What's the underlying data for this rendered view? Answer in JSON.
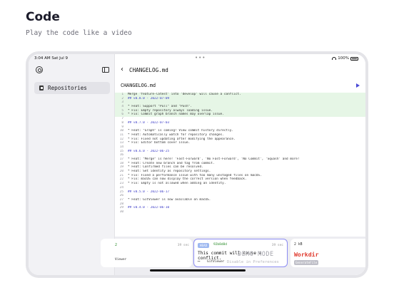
{
  "promo": {
    "title": "Code",
    "subtitle": "Play the code like a video"
  },
  "status_bar": {
    "time": "3:04 AM  Sat Jul 9",
    "dots": "•••",
    "battery": "100%"
  },
  "sidebar": {
    "items": [
      {
        "label": "Repositories",
        "icon": "repo-icon"
      }
    ]
  },
  "nav": {
    "back_icon": "chevron-left-icon",
    "title": "CHANGELOG.md"
  },
  "file": {
    "name": "CHANGELOG.md",
    "play_icon": "play-icon"
  },
  "code_lines": [
    {
      "n": "1",
      "t": "Merge 'feature-latest' into 'develop' will cause a conflict.",
      "hl": true,
      "h": false
    },
    {
      "n": "2",
      "t": "## v0.8.0 - 2022-07-09",
      "hl": true,
      "h": true
    },
    {
      "n": "3",
      "t": "",
      "hl": true,
      "h": false
    },
    {
      "n": "4",
      "t": "* Feat: Support \"Pull\" and \"Push\".",
      "hl": true,
      "h": false
    },
    {
      "n": "5",
      "t": "* Fix: Empty repository always loading issue.",
      "hl": true,
      "h": false
    },
    {
      "n": "6",
      "t": "* Fix: Commit graph branch names may overlap issue.",
      "hl": true,
      "h": false
    },
    {
      "n": "7",
      "t": "",
      "hl": false,
      "h": false
    },
    {
      "n": "8",
      "t": "## v0.7.0 - 2022-07-03",
      "hl": false,
      "h": true
    },
    {
      "n": "9",
      "t": "",
      "hl": false,
      "h": false
    },
    {
      "n": "10",
      "t": "* Feat: \"Graph\" is coming! View commit history directly.",
      "hl": false,
      "h": false
    },
    {
      "n": "11",
      "t": "* Feat: Automatically watch for repository changes.",
      "hl": false,
      "h": false
    },
    {
      "n": "12",
      "t": "* Fix: Fixed not updating after modifying the appearance.",
      "hl": false,
      "h": false
    },
    {
      "n": "13",
      "t": "* Fix: Editor bottom cover issue.",
      "hl": false,
      "h": false
    },
    {
      "n": "14",
      "t": "",
      "hl": false,
      "h": false
    },
    {
      "n": "15",
      "t": "## v0.6.0 - 2022-06-25",
      "hl": false,
      "h": true
    },
    {
      "n": "16",
      "t": "",
      "hl": false,
      "h": false
    },
    {
      "n": "17",
      "t": "* Feat: \"Merge\" is here! 'Fast-Forward', 'No Fast-Forward', 'No Commit', 'Squash' and more!",
      "hl": false,
      "h": false
    },
    {
      "n": "18",
      "t": "* Feat: Create new branch and tag from commit.",
      "hl": false,
      "h": false
    },
    {
      "n": "19",
      "t": "* Feat: Confirmed files can be resolved.",
      "hl": false,
      "h": false
    },
    {
      "n": "20",
      "t": "* Feat: Set identity as repository settings.",
      "hl": false,
      "h": false
    },
    {
      "n": "21",
      "t": "* Fix: Fixed a performance issue with too many unstaged files on macOS.",
      "hl": false,
      "h": false
    },
    {
      "n": "22",
      "t": "* Fix: macOS can now display the correct version when feedback.",
      "hl": false,
      "h": false
    },
    {
      "n": "23",
      "t": "* Fix: Empty is not allowed when adding an identity.",
      "hl": false,
      "h": false
    },
    {
      "n": "24",
      "t": "",
      "hl": false,
      "h": false
    },
    {
      "n": "25",
      "t": "## v0.5.0 - 2022-06-17",
      "hl": false,
      "h": true
    },
    {
      "n": "26",
      "t": "",
      "hl": false,
      "h": false
    },
    {
      "n": "27",
      "t": "* Feat: GitViewer is now available on macOS.",
      "hl": false,
      "h": false
    },
    {
      "n": "28",
      "t": "",
      "hl": false,
      "h": false
    },
    {
      "n": "29",
      "t": "## v0.4.0 - 2022-06-10",
      "hl": false,
      "h": true
    },
    {
      "n": "30",
      "t": "",
      "hl": false,
      "h": false
    }
  ],
  "cards": {
    "prev": {
      "number": "2",
      "time": "39 sec",
      "label": "Viewer"
    },
    "current": {
      "badge": "HEAD",
      "hash": "92b8d8d",
      "time": "39 sec",
      "message": "This commit will cause a conflict.",
      "arrow": "⟷",
      "author": "GitViewer"
    },
    "next": {
      "size": "2 kB",
      "workdir": "Workdir",
      "ref": "GenerateFile"
    }
  },
  "overlay": {
    "demo": "DEMO MODE",
    "demo_sub": "Disable in Preferences"
  },
  "colors": {
    "accent": "#4b4bd6",
    "highlight": "#e6f6e6",
    "workdir": "#e03a2e"
  }
}
